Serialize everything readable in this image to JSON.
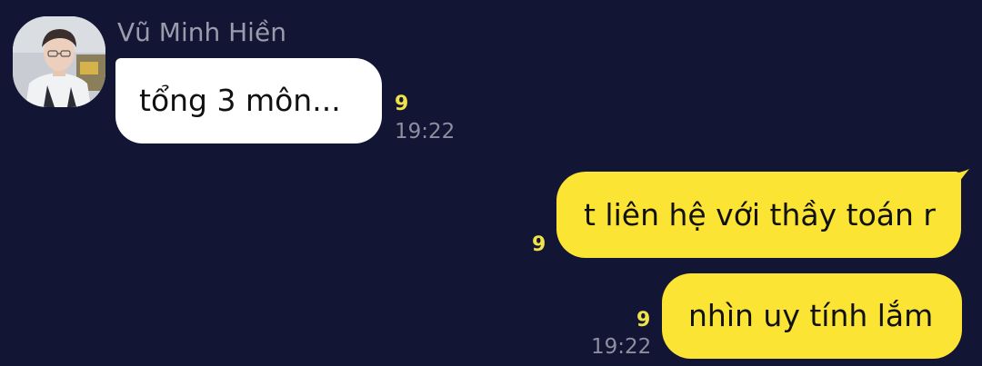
{
  "colors": {
    "background": "#121533",
    "incoming_bubble": "#ffffff",
    "outgoing_bubble": "#fbe433",
    "unread_count": "#f0e24a",
    "meta_text": "#8d8fa0",
    "sender_name": "#9a9cac"
  },
  "incoming": {
    "sender_name": "Vũ Minh Hiền",
    "avatar_icon": "profile-photo",
    "message": {
      "text": "tổng 3 môn...",
      "unread": "9",
      "time": "19:22"
    }
  },
  "outgoing": [
    {
      "text": "t liên hệ với thầy toán r",
      "unread": "9",
      "time": ""
    },
    {
      "text": "nhìn uy tính lắm",
      "unread": "9",
      "time": "19:22"
    }
  ]
}
